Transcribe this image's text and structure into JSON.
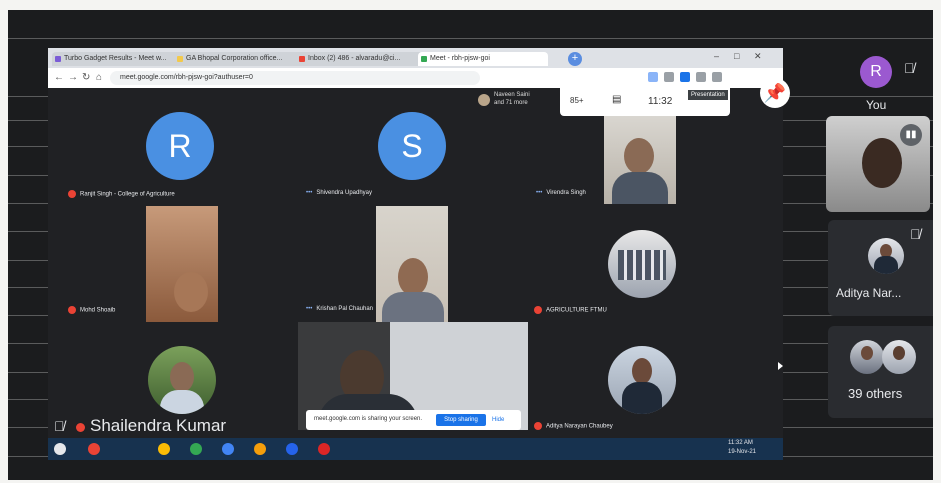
{
  "browser": {
    "tabs": [
      {
        "label": "Turbo Gadget Results - Meet w...",
        "favicon_color": "#7b5cd6"
      },
      {
        "label": "GA Bhopal Corporation office...",
        "favicon_color": "#f2c94c"
      },
      {
        "label": "Inbox (2) 486 - alvaradu@ci...",
        "favicon_color": "#ea4335"
      },
      {
        "label": "Meet - rbh-pjsw-goi",
        "favicon_color": "#34a853"
      }
    ],
    "new_tab": "+",
    "url": "meet.google.com/rbh-pjsw-goi?authuser=0",
    "window_controls": [
      "–",
      "□",
      "✕"
    ]
  },
  "meet_top": {
    "presenter_line1": "Naveen Saini",
    "presenter_line2": "and 71 more",
    "participants_count": "85+",
    "time": "11:32",
    "presenting_label": "Presentation"
  },
  "tiles": {
    "ranjit": {
      "initial": "R",
      "name": "Ranjit Singh - College of Agriculture",
      "color": "#4a90e2"
    },
    "shivendra": {
      "initial": "S",
      "name": "Shivendra Upadhyay",
      "color": "#4a90e2"
    },
    "virendra": {
      "name": "Virendra Singh"
    },
    "mohd": {
      "name": "Mohd Shoaib"
    },
    "krishan": {
      "name": "Krishan Pal Chauhan"
    },
    "agri": {
      "name": "AGRICULTURE FTMU"
    },
    "shailendra": {
      "name": "Shailendra Kumar"
    },
    "aditya_small": {
      "name": "Aditya Narayan Chaubey"
    }
  },
  "share_bar": {
    "text": "meet.google.com is sharing your screen.",
    "stop": "Stop sharing",
    "hide": "Hide"
  },
  "taskbar": {
    "time": "11:32 AM",
    "date": "19-Nov-21"
  },
  "sidebar": {
    "you": {
      "initial": "R",
      "label": "You",
      "color": "#9b59d0"
    },
    "aditya": {
      "label": "Aditya Nar..."
    },
    "others": {
      "label": "39 others"
    }
  }
}
